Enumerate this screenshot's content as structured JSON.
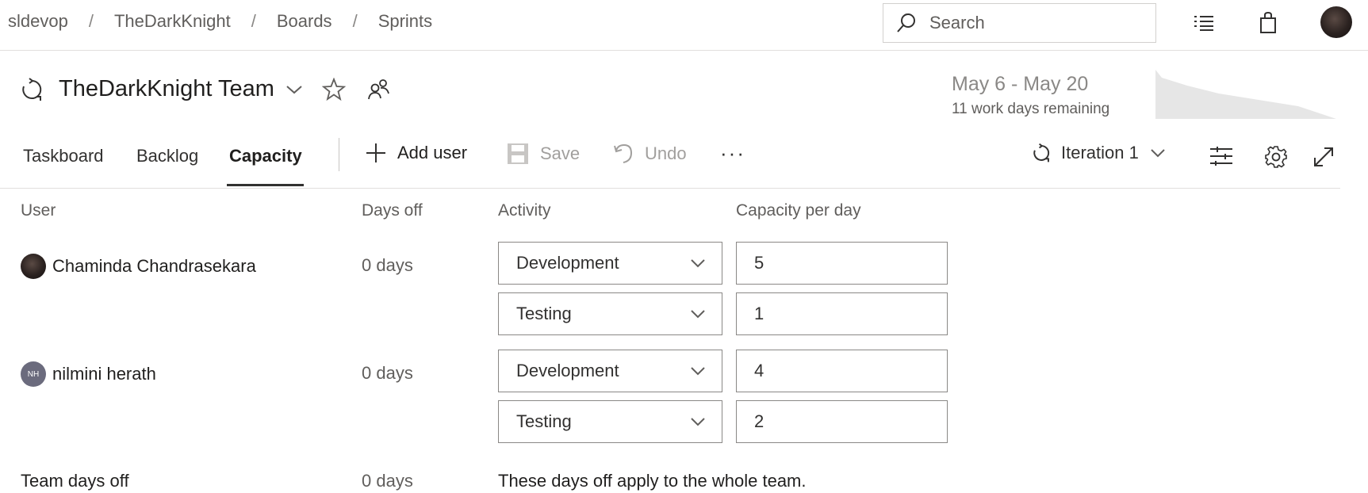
{
  "breadcrumb": [
    "sldevop",
    "TheDarkKnight",
    "Boards",
    "Sprints"
  ],
  "breadcrumb_separator": "/",
  "search": {
    "placeholder": "Search"
  },
  "top_icons": [
    "list-settings-icon",
    "shopping-bag-icon"
  ],
  "team": {
    "title": "TheDarkKnight Team"
  },
  "sprint": {
    "range": "May 6 - May 20",
    "remaining": "11 work days remaining"
  },
  "tabs": [
    {
      "label": "Taskboard",
      "active": false
    },
    {
      "label": "Backlog",
      "active": false
    },
    {
      "label": "Capacity",
      "active": true
    }
  ],
  "toolbar": {
    "add_user": "Add user",
    "save": "Save",
    "undo": "Undo",
    "more": "···",
    "iteration": "Iteration 1"
  },
  "columns": {
    "user": "User",
    "days_off": "Days off",
    "activity": "Activity",
    "capacity": "Capacity per day"
  },
  "members": [
    {
      "name": "Chaminda Chandrasekara",
      "days_off": "0 days",
      "activities": [
        {
          "activity": "Development",
          "capacity": "5"
        },
        {
          "activity": "Testing",
          "capacity": "1"
        }
      ]
    },
    {
      "name": "nilmini herath",
      "initials": "NH",
      "days_off": "0 days",
      "activities": [
        {
          "activity": "Development",
          "capacity": "4"
        },
        {
          "activity": "Testing",
          "capacity": "2"
        }
      ]
    }
  ],
  "team_days_off": {
    "label": "Team days off",
    "value": "0 days",
    "note": "These days off apply to the whole team."
  },
  "colors": {
    "text": "#201f1e",
    "muted": "#605e5c",
    "border": "#8a8886",
    "disabled": "#a19f9d",
    "burndown": "#e6e6e6"
  }
}
